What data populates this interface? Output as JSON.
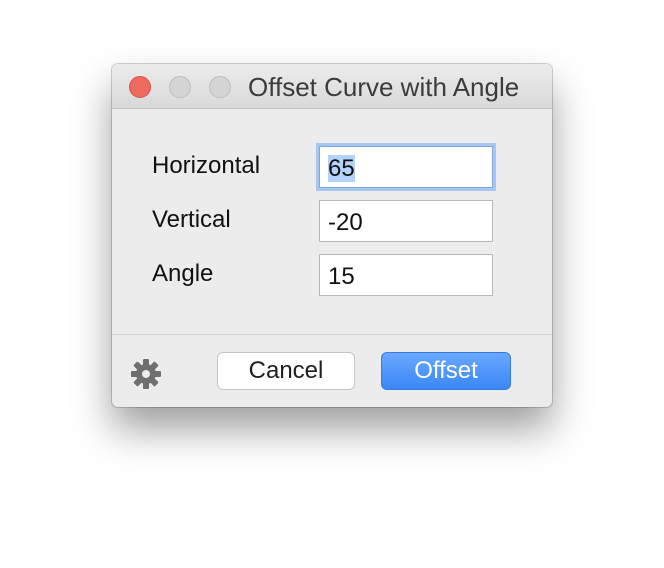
{
  "window": {
    "title": "Offset Curve with Angle",
    "traffic_lights": [
      "close",
      "minimize",
      "zoom"
    ]
  },
  "form": {
    "horizontal": {
      "label": "Horizontal",
      "value": "65",
      "focused": true,
      "text_selected": true
    },
    "vertical": {
      "label": "Vertical",
      "value": "-20"
    },
    "angle": {
      "label": "Angle",
      "value": "15"
    }
  },
  "footer": {
    "settings_icon": "gear-icon",
    "cancel_label": "Cancel",
    "offset_label": "Offset"
  },
  "colors": {
    "close": "#ef6a5e",
    "primary_button": "#3a87f5",
    "focus_ring": "#a6c6f3",
    "selection": "#b4d3fb"
  }
}
